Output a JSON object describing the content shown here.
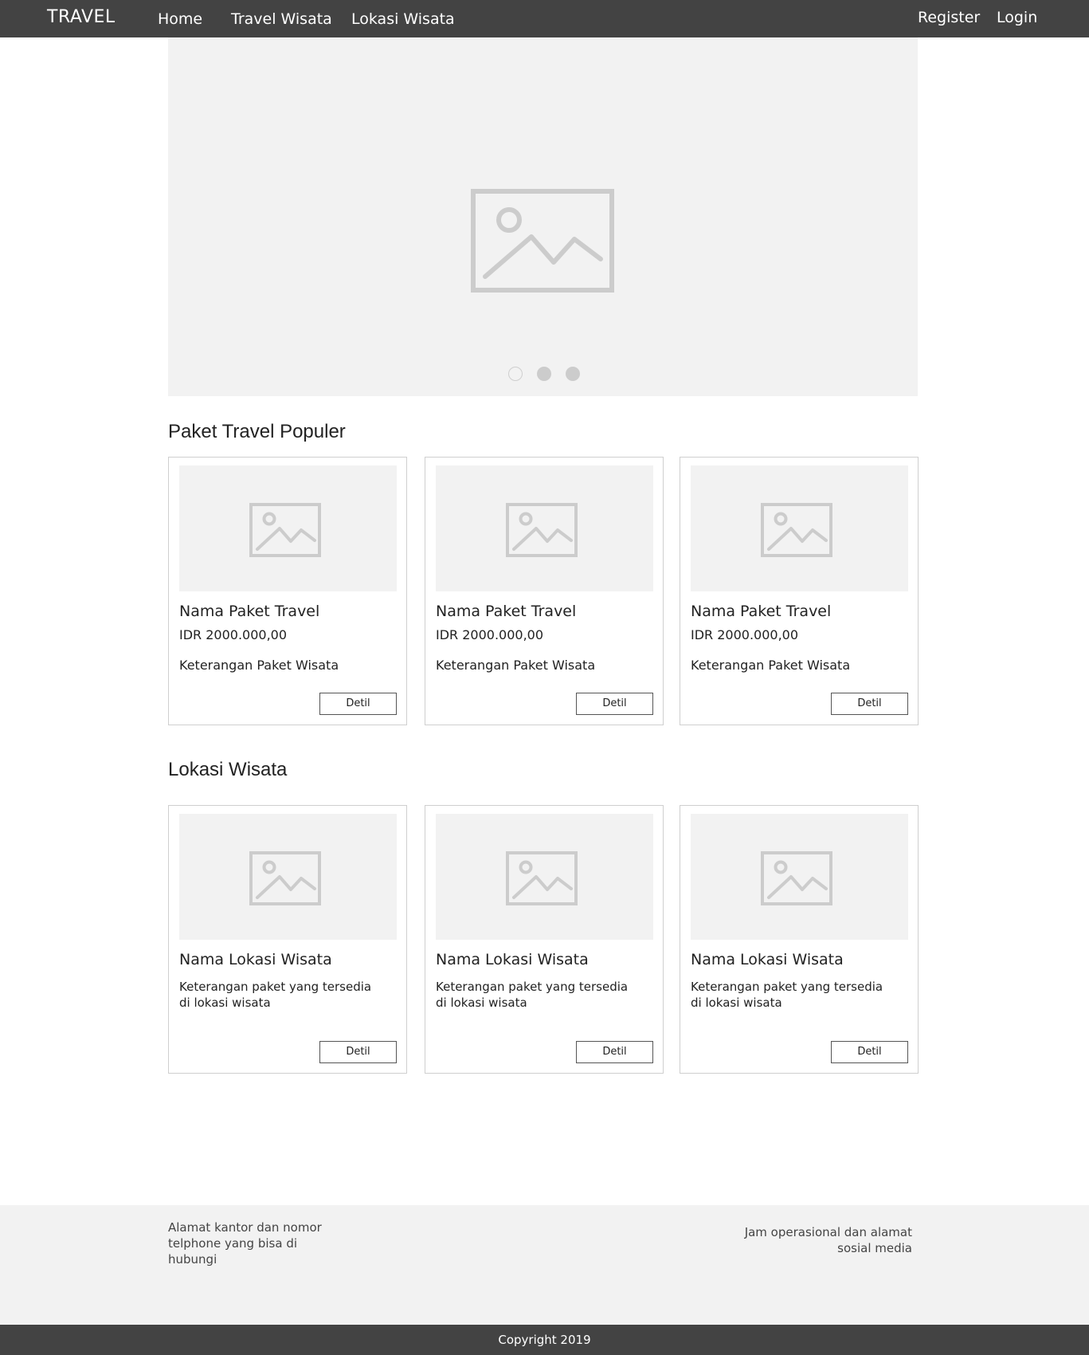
{
  "navbar": {
    "brand": "TRAVEL",
    "links": [
      {
        "label": "Home"
      },
      {
        "label": "Travel Wisata"
      },
      {
        "label": "Lokasi Wisata"
      }
    ],
    "register_label": "Register",
    "login_label": "Login"
  },
  "hero": {
    "image_icon": "image-placeholder-icon",
    "slides_count": 3,
    "active_slide": 1
  },
  "paket_section": {
    "title": "Paket Travel Populer",
    "cards": [
      {
        "title": "Nama Paket Travel",
        "price": "IDR 2000.000,00",
        "description": "Keterangan Paket Wisata",
        "button_label": "Detil"
      },
      {
        "title": "Nama Paket Travel",
        "price": "IDR 2000.000,00",
        "description": "Keterangan Paket Wisata",
        "button_label": "Detil"
      },
      {
        "title": "Nama Paket Travel",
        "price": "IDR 2000.000,00",
        "description": "Keterangan Paket Wisata",
        "button_label": "Detil"
      }
    ]
  },
  "lokasi_section": {
    "title": "Lokasi Wisata",
    "cards": [
      {
        "title": "Nama Lokasi Wisata",
        "description": "Keterangan paket yang tersedia di lokasi wisata",
        "button_label": "Detil"
      },
      {
        "title": "Nama Lokasi Wisata",
        "description": "Keterangan paket yang tersedia di lokasi wisata",
        "button_label": "Detil"
      },
      {
        "title": "Nama Lokasi Wisata",
        "description": "Keterangan paket yang tersedia di lokasi wisata",
        "button_label": "Detil"
      }
    ]
  },
  "footer": {
    "left_text": "Alamat kantor dan nomor telphone yang bisa di hubungi",
    "right_text": "Jam operasional dan alamat sosial media",
    "copyright": "Copyright 2019"
  },
  "colors": {
    "navbar_bg": "#434343",
    "placeholder_bg": "#f2f2f2",
    "placeholder_icon": "#cccccc",
    "card_border": "#cfcfcf"
  }
}
